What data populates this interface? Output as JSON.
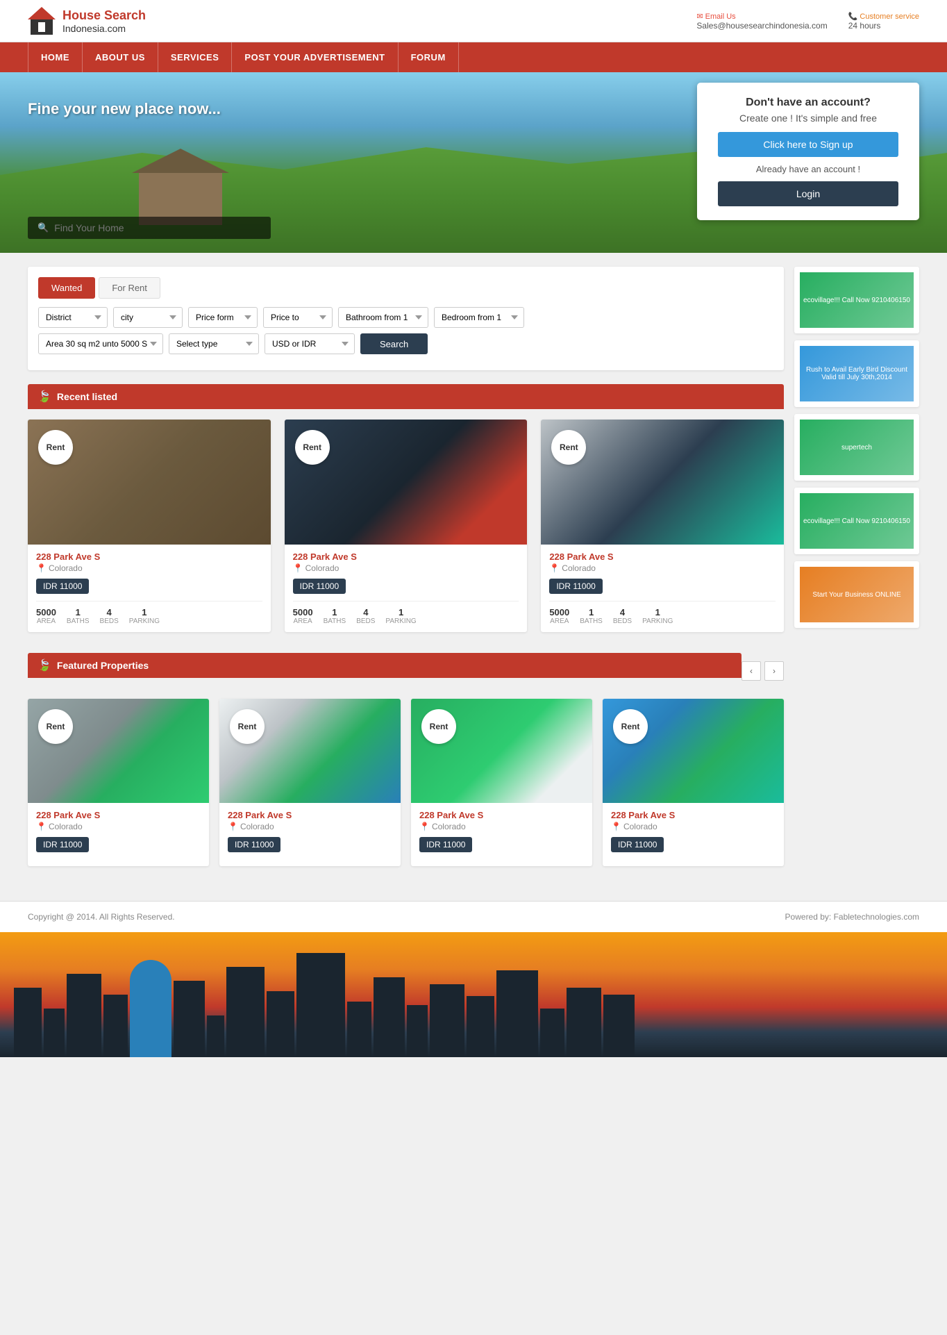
{
  "header": {
    "logo_title": "House Search",
    "logo_subtitle": "Indonesia.com",
    "email_label": "Email Us",
    "email_value": "Sales@housesearchindonesia.com",
    "service_label": "Customer service",
    "service_value": "24 hours"
  },
  "nav": {
    "items": [
      "HOME",
      "ABOUT US",
      "SERVICES",
      "POST YOUR ADVERTISEMENT",
      "FORUM"
    ]
  },
  "hero": {
    "tagline": "Fine your new place now...",
    "search_placeholder": "Find Your Home"
  },
  "signup_card": {
    "dont_have": "Don't have an account?",
    "create": "Create one ! It's simple and free",
    "signup_btn": "Click here to Sign up",
    "already": "Already have an account !",
    "login_btn": "Login"
  },
  "search": {
    "tab_wanted": "Wanted",
    "tab_for_rent": "For Rent",
    "district_label": "District",
    "city_label": "city",
    "price_from_label": "Price form",
    "price_to_label": "Price to",
    "bathroom_label": "Bathroom from 1",
    "bedroom_label": "Bedroom from 1",
    "area_label": "Area 30 sq m2 unto 5000 Sq",
    "type_label": "Select type",
    "currency_label": "USD or IDR",
    "search_btn": "Search"
  },
  "recent": {
    "title": "Recent listed",
    "cards": [
      {
        "badge": "Rent",
        "address": "228 Park Ave S",
        "location": "Colorado",
        "price": "IDR  11000",
        "area": "5000",
        "baths": "1",
        "beds": "4",
        "parking": "1",
        "img_class": "img-bedroom1"
      },
      {
        "badge": "Rent",
        "address": "228 Park Ave S",
        "location": "Colorado",
        "price": "IDR  11000",
        "area": "5000",
        "baths": "1",
        "beds": "4",
        "parking": "1",
        "img_class": "img-bedroom2"
      },
      {
        "badge": "Rent",
        "address": "228 Park Ave S",
        "location": "Colorado",
        "price": "IDR  11000",
        "area": "5000",
        "baths": "1",
        "beds": "4",
        "parking": "1",
        "img_class": "img-modern"
      }
    ]
  },
  "featured": {
    "title": "Featured Properties",
    "cards": [
      {
        "badge": "Rent",
        "address": "228 Park Ave S",
        "location": "Colorado",
        "price": "IDR  11000",
        "img_class": "img-house1"
      },
      {
        "badge": "Rent",
        "address": "228 Park Ave S",
        "location": "Colorado",
        "price": "IDR  11000",
        "img_class": "img-house2"
      },
      {
        "badge": "Rent",
        "address": "228 Park Ave S",
        "location": "Colorado",
        "price": "IDR  11000",
        "img_class": "img-house3"
      },
      {
        "badge": "Rent",
        "address": "228 Park Ave S",
        "location": "Colorado",
        "price": "IDR  11000",
        "img_class": "img-house4"
      }
    ]
  },
  "footer": {
    "copyright": "Copyright @ 2014. All Rights Reserved.",
    "powered": "Powered by: Fabletechnologies.com"
  },
  "sidebar": {
    "ads": [
      {
        "text": "ecovillage!!! Call Now 9210406150",
        "type": "green"
      },
      {
        "text": "Rush to Avail Early Bird Discount Valid till July 30th,2014",
        "type": "blue"
      },
      {
        "text": "supertech",
        "type": "green"
      },
      {
        "text": "ecovillage!!! Call Now 9210406150",
        "type": "green"
      },
      {
        "text": "Start Your Business ONLINE",
        "type": "orange"
      }
    ]
  }
}
